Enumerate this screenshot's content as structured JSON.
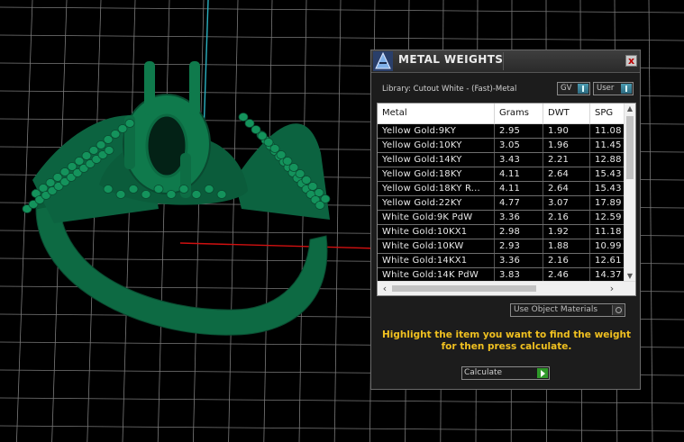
{
  "panel": {
    "title": "METAL WEIGHTS",
    "close_glyph": "x",
    "library_label": "Library: Cutout White - (Fast)-Metal",
    "toggles": {
      "gv": "GV",
      "user": "User"
    },
    "table": {
      "headers": [
        "Metal",
        "Grams",
        "DWT",
        "SPG"
      ],
      "rows": [
        [
          "Yellow Gold:9KY",
          "2.95",
          "1.90",
          "11.08"
        ],
        [
          "Yellow Gold:10KY",
          "3.05",
          "1.96",
          "11.45"
        ],
        [
          "Yellow Gold:14KY",
          "3.43",
          "2.21",
          "12.88"
        ],
        [
          "Yellow Gold:18KY",
          "4.11",
          "2.64",
          "15.43"
        ],
        [
          "Yellow Gold:18KY R...",
          "4.11",
          "2.64",
          "15.43"
        ],
        [
          "Yellow Gold:22KY",
          "4.77",
          "3.07",
          "17.89"
        ],
        [
          "White Gold:9K PdW",
          "3.36",
          "2.16",
          "12.59"
        ],
        [
          "White Gold:10KX1",
          "2.98",
          "1.92",
          "11.18"
        ],
        [
          "White Gold:10KW",
          "2.93",
          "1.88",
          "10.99"
        ],
        [
          "White Gold:14KX1",
          "3.36",
          "2.16",
          "12.61"
        ],
        [
          "White Gold:14K PdW",
          "3.83",
          "2.46",
          "14.37"
        ]
      ]
    },
    "use_object_materials": "Use Object Materials",
    "instructions": "Highlight the item you want to find the weight for then press calculate.",
    "calculate_label": "Calculate"
  },
  "colors": {
    "background": "#000000",
    "grid": "#7a7a7a",
    "axis_y": "#2ab0c0",
    "axis_x": "#d01010",
    "model": "#0e6b44",
    "instruction_text": "#f0c020"
  },
  "icons": {
    "app": "metal-weights-app-icon",
    "close": "close-icon",
    "calculate": "play-arrow-icon"
  }
}
